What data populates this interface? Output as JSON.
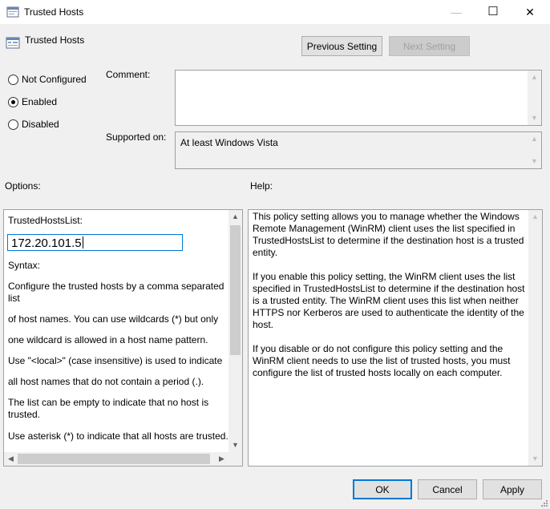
{
  "window": {
    "title": "Trusted Hosts",
    "minimize_glyph": "—",
    "maximize_glyph": "☐",
    "close_glyph": "✕"
  },
  "policy": {
    "name": "Trusted Hosts",
    "previous_label": "Previous Setting",
    "next_label": "Next Setting"
  },
  "state": {
    "options": [
      {
        "label": "Not Configured",
        "selected": false
      },
      {
        "label": "Enabled",
        "selected": true
      },
      {
        "label": "Disabled",
        "selected": false
      }
    ]
  },
  "comment": {
    "label": "Comment:",
    "value": ""
  },
  "supported": {
    "label": "Supported on:",
    "value": "At least Windows Vista"
  },
  "options_panel": {
    "heading": "Options:",
    "field_label": "TrustedHostsList:",
    "field_value": "172.20.101.5",
    "lines": [
      "Syntax:",
      "Configure the trusted hosts by a comma separated list",
      "of host names. You can use wildcards (*) but only",
      "one wildcard is allowed in a host name pattern.",
      "Use \"<local>\" (case insensitive) is used to indicate",
      "all host names that do not contain a period (.).",
      "The list can be empty to indicate that no host is trusted.",
      "Use asterisk (*)  to indicate that all hosts are trusted."
    ]
  },
  "help_panel": {
    "heading": "Help:",
    "paragraphs": [
      "This policy setting allows you to manage whether the Windows Remote Management (WinRM) client uses the list specified in TrustedHostsList to determine if the destination host is a trusted entity.",
      "If you enable this policy setting, the WinRM client uses the list specified in TrustedHostsList to determine if the destination host is a trusted entity. The WinRM client uses this list when neither HTTPS nor Kerberos are used to authenticate the identity of the host.",
      "If you disable or do not configure this policy setting and the WinRM client needs to use the list of trusted hosts, you must configure the list of trusted hosts locally on each computer."
    ]
  },
  "footer": {
    "ok_label": "OK",
    "cancel_label": "Cancel",
    "apply_label": "Apply"
  },
  "colors": {
    "accent": "#0078d7",
    "dialog_bg": "#f0f0f0"
  }
}
